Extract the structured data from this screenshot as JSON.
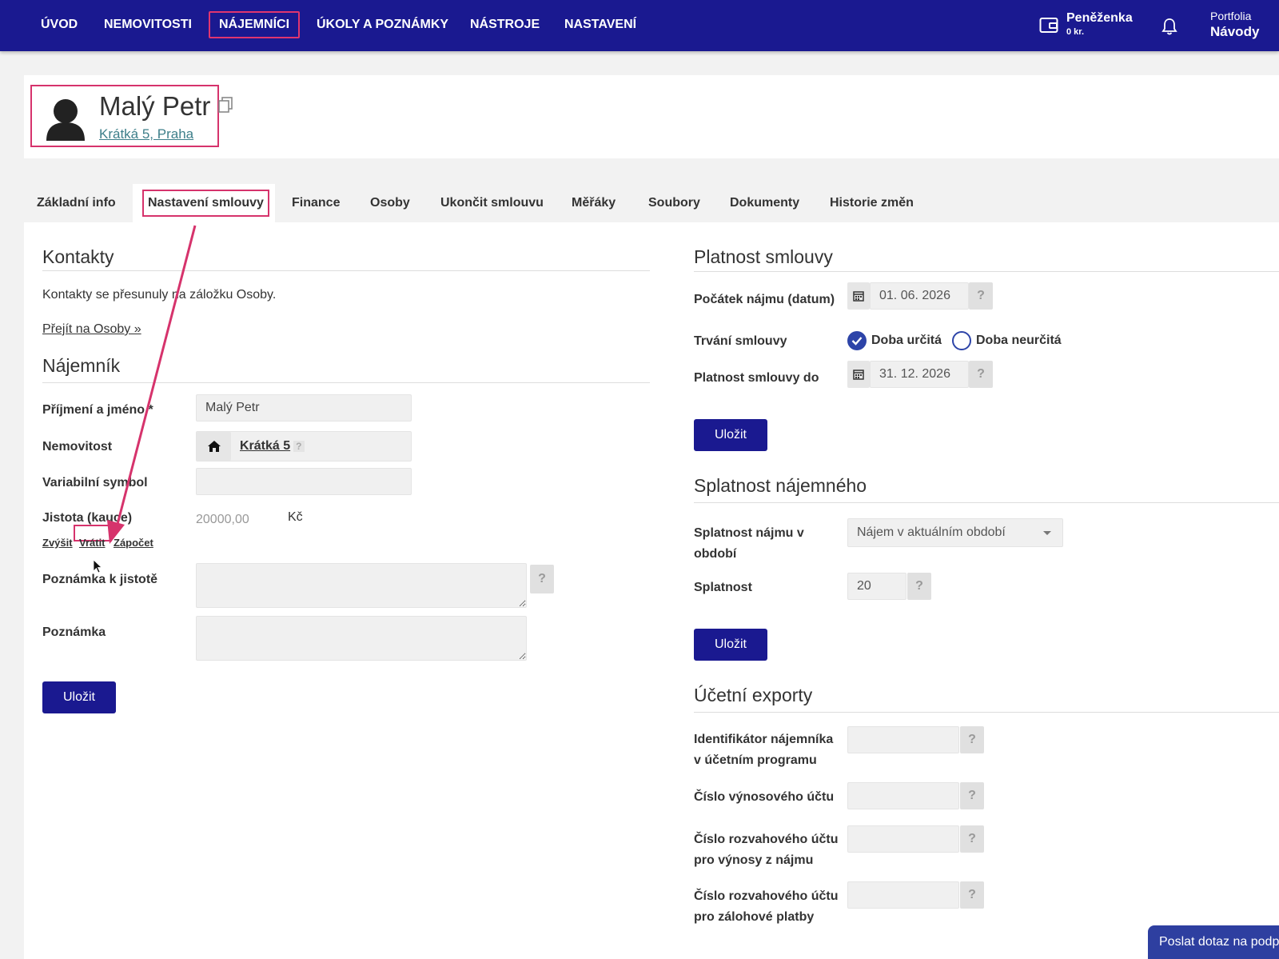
{
  "nav": {
    "items": [
      {
        "label": "ÚVOD"
      },
      {
        "label": "NEMOVITOSTI"
      },
      {
        "label": "NÁJEMNÍCI"
      },
      {
        "label": "ÚKOLY A POZNÁMKY"
      },
      {
        "label": "NÁSTROJE"
      },
      {
        "label": "NASTAVENÍ"
      }
    ],
    "wallet": {
      "label": "Peněženka",
      "amount": "0 kr."
    },
    "portfolio": {
      "small": "Portfolia",
      "big": "Návody"
    }
  },
  "profile": {
    "name": "Malý Petr",
    "address": "Krátká 5, Praha"
  },
  "tabs": [
    {
      "label": "Základní info"
    },
    {
      "label": "Nastavení smlouvy"
    },
    {
      "label": "Finance"
    },
    {
      "label": "Osoby"
    },
    {
      "label": "Ukončit smlouvu"
    },
    {
      "label": "Měřáky"
    },
    {
      "label": "Soubory"
    },
    {
      "label": "Dokumenty"
    },
    {
      "label": "Historie změn"
    }
  ],
  "contacts": {
    "title": "Kontakty",
    "text": "Kontakty se přesunuly na záložku Osoby.",
    "link": "Přejít na Osoby »"
  },
  "tenant": {
    "title": "Nájemník",
    "name_label": "Příjmení a jméno",
    "name_required": "*",
    "name_value": "Malý Petr",
    "property_label": "Nemovitost",
    "property_value": "Krátká 5",
    "property_help": "?",
    "vs_label": "Variabilní symbol",
    "vs_value": "",
    "deposit_label": "Jistota (kauce)",
    "deposit_value": "20000,00",
    "deposit_currency": "Kč",
    "deposit_actions": [
      "Zvýšit",
      "Vrátit",
      "Zápočet"
    ],
    "deposit_note_label": "Poznámka k jistotě",
    "note_label": "Poznámka",
    "help": "?",
    "save": "Uložit"
  },
  "validity": {
    "title": "Platnost smlouvy",
    "start_label": "Počátek nájmu (datum)",
    "start_value": "01. 06. 2026",
    "duration_label": "Trvání smlouvy",
    "option_fixed": "Doba určitá",
    "option_indefinite": "Doba neurčitá",
    "selected": "Doba určitá",
    "end_label": "Platnost smlouvy do",
    "end_value": "31. 12. 2026",
    "help": "?",
    "save": "Uložit"
  },
  "due": {
    "title": "Splatnost nájemného",
    "period_label_1": "Splatnost nájmu v",
    "period_label_2": "období",
    "period_value": "Nájem v aktuálním období",
    "due_label": "Splatnost",
    "due_value": "20",
    "help": "?",
    "save": "Uložit"
  },
  "exports": {
    "title": "Účetní exporty",
    "fields": [
      {
        "line1": "Identifikátor nájemníka",
        "line2": "v účetním programu",
        "value": ""
      },
      {
        "line1": "Číslo výnosového účtu",
        "line2": "",
        "value": ""
      },
      {
        "line1": "Číslo rozvahového účtu",
        "line2": "pro výnosy z nájmu",
        "value": ""
      },
      {
        "line1": "Číslo rozvahového účtu",
        "line2": "pro zálohové platby",
        "value": ""
      }
    ],
    "help": "?"
  },
  "floating": {
    "label": "Poslat dotaz na podporu"
  },
  "colors": {
    "nav_bg": "#1a1990",
    "highlight": "#d6336c",
    "button": "#1a1990",
    "radio": "#2d44a8"
  }
}
